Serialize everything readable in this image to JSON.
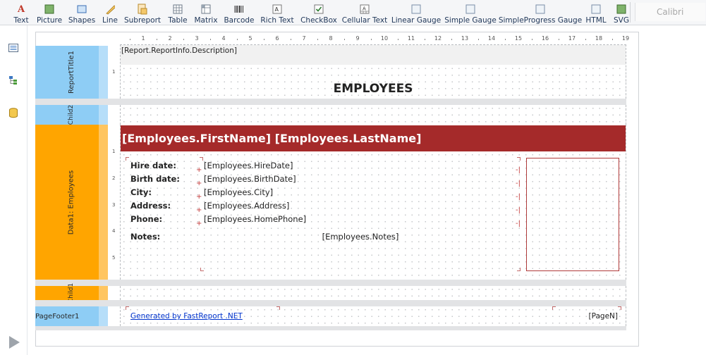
{
  "toolbar": {
    "items": [
      {
        "label": "Text",
        "icon": "text-icon",
        "color": "#c0392b"
      },
      {
        "label": "Picture",
        "icon": "picture-icon",
        "color": "#4b7f3a"
      },
      {
        "label": "Shapes",
        "icon": "shapes-icon",
        "color": "#3b6fb5"
      },
      {
        "label": "Line",
        "icon": "line-icon",
        "color": "#d6a23a"
      },
      {
        "label": "Subreport",
        "icon": "subreport-icon",
        "color": "#c8952e"
      },
      {
        "label": "Table",
        "icon": "table-icon",
        "color": "#6d7a88"
      },
      {
        "label": "Matrix",
        "icon": "matrix-icon",
        "color": "#6d7a88"
      },
      {
        "label": "Barcode",
        "icon": "barcode-icon",
        "color": "#333333"
      },
      {
        "label": "Rich Text",
        "icon": "rich-text-icon",
        "color": "#555555"
      },
      {
        "label": "CheckBox",
        "icon": "checkbox-icon",
        "color": "#2e7d32"
      },
      {
        "label": "Cellular Text",
        "icon": "cellular-text-icon",
        "color": "#555555"
      },
      {
        "label": "Linear Gauge",
        "icon": "linear-gauge-icon",
        "color": "#7a8fa8"
      },
      {
        "label": "Simple Gauge",
        "icon": "simple-gauge-icon",
        "color": "#7a8fa8"
      },
      {
        "label": "SimpleProgress Gauge",
        "icon": "simple-progress-gauge-icon",
        "color": "#7a8fa8"
      },
      {
        "label": "HTML",
        "icon": "html-icon",
        "color": "#7a8fa8"
      },
      {
        "label": "SVG",
        "icon": "svg-icon",
        "color": "#4b7f3a"
      }
    ],
    "font_name": "Calibri"
  },
  "leftbar": {
    "icons": [
      "report-tree-icon",
      "data-tree-icon",
      "database-icon"
    ],
    "bottom_icon": "play-icon"
  },
  "ruler": {
    "marks": [
      "1",
      "2",
      "3",
      "4",
      "5",
      "6",
      "7",
      "8",
      "9",
      "10",
      "11",
      "12",
      "13",
      "14",
      "15",
      "16",
      "17",
      "18",
      "19"
    ]
  },
  "bands": {
    "report_title": {
      "name": "ReportTitle1",
      "color": "#8ecdf5",
      "description": "[Report.ReportInfo.Description]",
      "heading": "EMPLOYEES",
      "vruler": [
        "1"
      ]
    },
    "child2": {
      "name": "Child2",
      "color": "#8ecdf5"
    },
    "data": {
      "name": "Data1: Employees",
      "color": "#ffa500",
      "header_text": "[Employees.FirstName] [Employees.LastName]",
      "header_color": "#a52a2a",
      "vruler": [
        "1",
        "2",
        "3",
        "4",
        "5"
      ],
      "fields": [
        {
          "label": "Hire date:",
          "value": "[Employees.HireDate]"
        },
        {
          "label": "Birth date:",
          "value": "[Employees.BirthDate]"
        },
        {
          "label": "City:",
          "value": "[Employees.City]"
        },
        {
          "label": "Address:",
          "value": "[Employees.Address]"
        },
        {
          "label": "Phone:",
          "value": "[Employees.HomePhone]"
        }
      ],
      "notes_label": "Notes:",
      "notes_value": "[Employees.Notes]",
      "photo_border_color": "#b03a3a"
    },
    "child1": {
      "name": "Child1",
      "color": "#ffa500"
    },
    "page_footer": {
      "name": "PageFooter1",
      "color": "#8ecdf5",
      "link": "Generated by FastReport .NET",
      "page_no": "[PageN]"
    }
  }
}
